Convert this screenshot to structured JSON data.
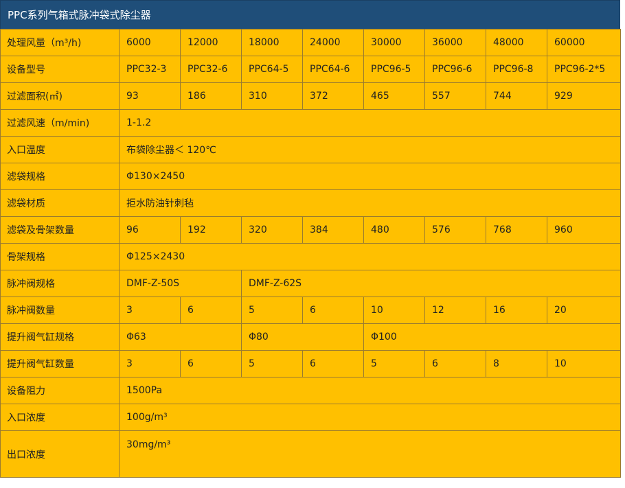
{
  "title": "PPC系列气箱式脉冲袋式除尘器",
  "colors": {
    "header_bg": "#1f4e79",
    "table_bg": "#ffc000",
    "border": "#9a7a30"
  },
  "rows": {
    "air_volume": {
      "label": "处理风量（m³/h)",
      "values": [
        "6000",
        "12000",
        "18000",
        "24000",
        "30000",
        "36000",
        "48000",
        "60000"
      ]
    },
    "model": {
      "label": "设备型号",
      "values": [
        "PPC32-3",
        "PPC32-6",
        "PPC64-5",
        "PPC64-6",
        "PPC96-5",
        "PPC96-6",
        "PPC96-8",
        "PPC96-2*5"
      ]
    },
    "filter_area": {
      "label": "过滤面积(㎡)",
      "values": [
        "93",
        "186",
        "310",
        "372",
        "465",
        "557",
        "744",
        "929"
      ]
    },
    "filter_speed": {
      "label": "过滤风速（m/min)",
      "value": "1-1.2"
    },
    "inlet_temp": {
      "label": "入口温度",
      "value": "布袋除尘器＜ 120℃"
    },
    "bag_spec": {
      "label": "滤袋规格",
      "value": "Φ130×2450"
    },
    "bag_material": {
      "label": "滤袋材质",
      "value": "拒水防油针刺毡"
    },
    "bag_cage_qty": {
      "label": "滤袋及骨架数量",
      "values": [
        "96",
        "192",
        "320",
        "384",
        "480",
        "576",
        "768",
        "960"
      ]
    },
    "cage_spec": {
      "label": "骨架规格",
      "value": "Φ125×2430"
    },
    "pulse_valve_spec": {
      "label": "脉冲阀规格",
      "values": [
        "DMF-Z-50S",
        "DMF-Z-62S"
      ]
    },
    "pulse_valve_qty": {
      "label": "脉冲阀数量",
      "values": [
        "3",
        "6",
        "5",
        "6",
        "10",
        "12",
        "16",
        "20"
      ]
    },
    "lift_cylinder_spec": {
      "label": "提升阀气缸规格",
      "values": [
        "Φ63",
        "Φ80",
        "Φ100"
      ]
    },
    "lift_cylinder_qty": {
      "label": "提升阀气缸数量",
      "values": [
        "3",
        "6",
        "5",
        "6",
        "5",
        "6",
        "8",
        "10"
      ]
    },
    "resistance": {
      "label": "设备阻力",
      "value": "1500Pa"
    },
    "inlet_conc": {
      "label": "入口浓度",
      "value": "100g/m³"
    },
    "outlet_conc": {
      "label": "出口浓度",
      "value": "30mg/m³"
    }
  }
}
